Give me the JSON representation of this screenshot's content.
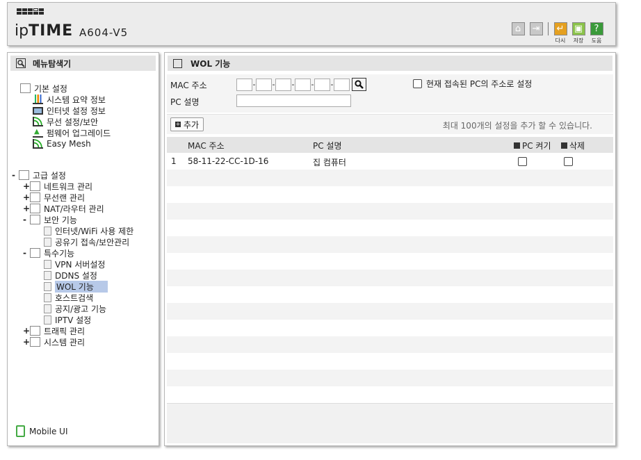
{
  "header": {
    "logo_prefix": "ip",
    "logo_brand": "TIME",
    "model": "A604-V5",
    "buttons": [
      {
        "name": "home",
        "caption": ""
      },
      {
        "name": "logout",
        "caption": ""
      },
      {
        "name": "refresh",
        "caption": "다시"
      },
      {
        "name": "save",
        "caption": "저장"
      },
      {
        "name": "help",
        "caption": "도움"
      }
    ]
  },
  "sidebar": {
    "title": "메뉴탐색기",
    "basic": {
      "label": "기본 설정",
      "items": [
        "시스템 요약 정보",
        "인터넷 설정 정보",
        "무선 설정/보안",
        "펌웨어 업그레이드",
        "Easy Mesh"
      ]
    },
    "advanced": {
      "label": "고급 설정",
      "groups": [
        {
          "toggle": "+",
          "label": "네트워크 관리"
        },
        {
          "toggle": "+",
          "label": "무선랜 관리"
        },
        {
          "toggle": "+",
          "label": "NAT/라우터 관리"
        },
        {
          "toggle": "-",
          "label": "보안 기능"
        },
        {
          "toggle": "-",
          "label": "특수기능"
        },
        {
          "toggle": "+",
          "label": "트래픽 관리"
        },
        {
          "toggle": "+",
          "label": "시스템 관리"
        }
      ],
      "security_items": [
        "인터넷/WiFi 사용 제한",
        "공유기 접속/보안관리"
      ],
      "special_items": [
        "VPN 서버설정",
        "DDNS 설정",
        "WOL 기능",
        "호스트검색",
        "공지/광고 기능",
        "IPTV 설정"
      ]
    },
    "mobile_label": "Mobile UI"
  },
  "main": {
    "title": "WOL 기능",
    "mac_label": "MAC 주소",
    "desc_label": "PC 설명",
    "current_pc_label": "현재 접속된 PC의 주소로 설정",
    "add_label": "추가",
    "max_info": "최대 100개의 설정을 추가 할 수 있습니다.",
    "columns": {
      "mac": "MAC 주소",
      "desc": "PC 설명",
      "wake": "PC 켜기",
      "delete": "삭제"
    },
    "entries": [
      {
        "index": "1",
        "mac": "58-11-22-CC-1D-16",
        "desc": "집 컴퓨터"
      }
    ]
  },
  "colors": {
    "selected": "#b7c9e8",
    "panel": "#e4e4e4",
    "refresh": "#e5a020",
    "save": "#8bc34a",
    "help": "#3a9a3a"
  }
}
